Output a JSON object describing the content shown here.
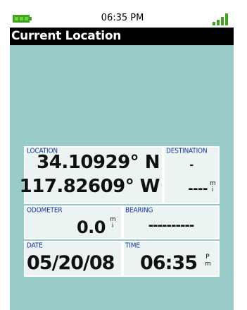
{
  "status_bar": {
    "time": "06:35 PM",
    "battery_icon": "battery-full-icon",
    "signal_icon": "signal-strength-icon",
    "icon_color": "#3fa51e"
  },
  "title_bar": {
    "title": "Current Location"
  },
  "location": {
    "label": "LOCATION",
    "latitude": "34.10929° N",
    "longitude": "117.82609° W"
  },
  "destination": {
    "label": "DESTINATION",
    "value": "-",
    "distance": "----",
    "unit_line1": "m",
    "unit_line2": "i"
  },
  "odometer": {
    "label": "ODOMETER",
    "value": "0.0",
    "unit_line1": "m",
    "unit_line2": "i"
  },
  "bearing": {
    "label": "BEARING",
    "value": "----------"
  },
  "date": {
    "label": "DATE",
    "value": "05/20/08"
  },
  "time": {
    "label": "TIME",
    "value": "06:35",
    "ampm_line1": "P",
    "ampm_line2": "m"
  },
  "colors": {
    "background": "#98cbc8",
    "panel": "#ebf4f3",
    "label": "#1238a8"
  }
}
